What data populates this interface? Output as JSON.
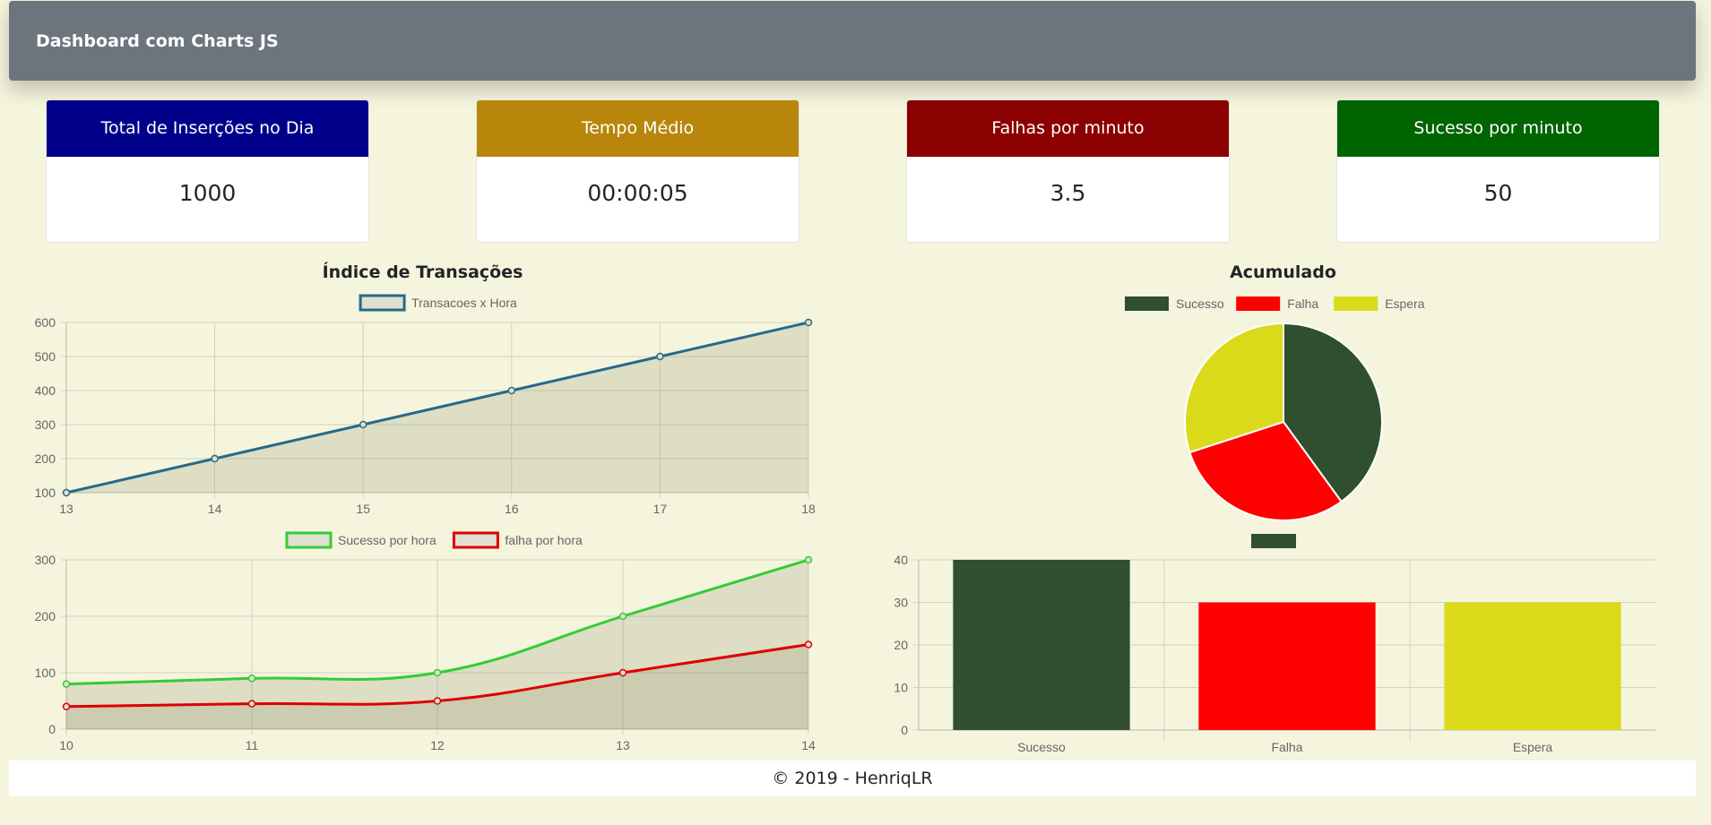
{
  "navbar": {
    "brand": "Dashboard com Charts JS"
  },
  "cards": [
    {
      "title": "Total de Inserções no Dia",
      "value": "1000",
      "color": "#00008b"
    },
    {
      "title": "Tempo Médio",
      "value": "00:00:05",
      "color": "#b8860b"
    },
    {
      "title": "Falhas por minuto",
      "value": "3.5",
      "color": "#8b0000"
    },
    {
      "title": "Sucesso por minuto",
      "value": "50",
      "color": "#006400"
    }
  ],
  "chart_data": [
    {
      "type": "line",
      "title": "Índice de Transações",
      "x": [
        "13",
        "14",
        "15",
        "16",
        "17",
        "18"
      ],
      "series": [
        {
          "name": "Transacoes x Hora",
          "values": [
            100,
            200,
            300,
            400,
            500,
            600
          ],
          "color": "#27698b"
        }
      ],
      "yticks": [
        "600",
        "500",
        "400",
        "300",
        "200",
        "100"
      ],
      "ylim": [
        100,
        600
      ],
      "grid": true,
      "legend": "top"
    },
    {
      "type": "line",
      "title": "",
      "x": [
        "10",
        "11",
        "12",
        "13",
        "14"
      ],
      "series": [
        {
          "name": "Sucesso por hora",
          "values": [
            80,
            90,
            100,
            200,
            300
          ],
          "color": "#33cc33"
        },
        {
          "name": "falha por hora",
          "values": [
            40,
            45,
            50,
            100,
            150
          ],
          "color": "#dd0000"
        }
      ],
      "yticks": [
        "300",
        "200",
        "100",
        "0"
      ],
      "ylim": [
        0,
        300
      ],
      "grid": true,
      "legend": "top"
    },
    {
      "type": "pie",
      "title": "Acumulado",
      "categories": [
        "Sucesso",
        "Falha",
        "Espera"
      ],
      "values": [
        40,
        30,
        30
      ],
      "colors": [
        "#2f4f2f",
        "#ff0000",
        "#dada1a"
      ],
      "legend": "top"
    },
    {
      "type": "bar",
      "title": "",
      "categories": [
        "Sucesso",
        "Falha",
        "Espera"
      ],
      "values": [
        40,
        30,
        30
      ],
      "colors": [
        "#2f4f2f",
        "#ff0000",
        "#dada1a"
      ],
      "yticks": [
        "40",
        "30",
        "20",
        "10",
        "0"
      ],
      "ylim": [
        0,
        40
      ],
      "grid": true,
      "legend": "top"
    }
  ],
  "footer": {
    "text": "© 2019 - HenriqLR"
  }
}
